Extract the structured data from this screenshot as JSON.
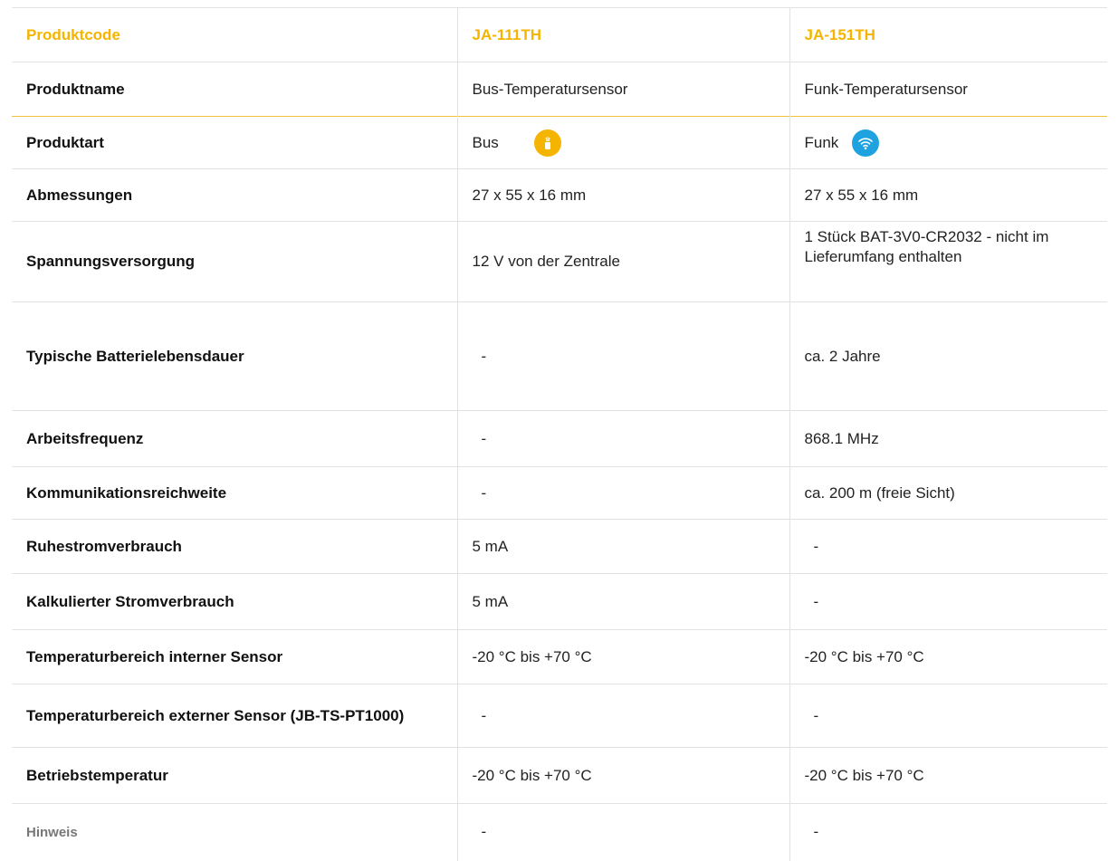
{
  "header": {
    "label": "Produktcode",
    "col1": "JA-111TH",
    "col2": "JA-151TH"
  },
  "rows": [
    {
      "label": "Produktname",
      "v1": "Bus-Temperatursensor",
      "v2": "Funk-Temperatursensor"
    },
    {
      "label": "Produktart",
      "v1": "Bus",
      "v2": "Funk"
    },
    {
      "label": "Abmessungen",
      "v1": "27 x 55 x 16 mm",
      "v2": "27 x 55 x 16 mm"
    },
    {
      "label": "Spannungsversorgung",
      "v1": "12 V von der Zentrale",
      "v2": "1 Stück BAT-3V0-CR2032 - nicht im Lieferumfang enthalten"
    },
    {
      "label": "Typische Batterielebensdauer",
      "v1": "-",
      "v2": "ca. 2 Jahre"
    },
    {
      "label": "Arbeitsfrequenz",
      "v1": "-",
      "v2": "868.1 MHz"
    },
    {
      "label": "Kommunikationsreichweite",
      "v1": "-",
      "v2": "ca. 200 m (freie Sicht)"
    },
    {
      "label": "Ruhestromverbrauch",
      "v1": "5 mA",
      "v2": "-"
    },
    {
      "label": "Kalkulierter Stromverbrauch",
      "v1": "5 mA",
      "v2": "-"
    },
    {
      "label": "Temperaturbereich interner Sensor",
      "v1": "-20 °C bis +70 °C",
      "v2": "-20 °C bis +70 °C"
    },
    {
      "label": "Temperaturbereich externer Sensor (JB-TS-PT1000)",
      "v1": "-",
      "v2": "-"
    },
    {
      "label": "Betriebstemperatur",
      "v1": "-20 °C bis +70 °C",
      "v2": "-20 °C bis +70 °C"
    },
    {
      "label": "Hinweis",
      "v1": "-",
      "v2": "-"
    }
  ],
  "icons": {
    "bus": "bus-line-icon",
    "funk": "wireless-icon"
  },
  "colors": {
    "accent": "#f4b400",
    "funk_badge": "#1ea3e0",
    "border": "#e2e2e2"
  }
}
